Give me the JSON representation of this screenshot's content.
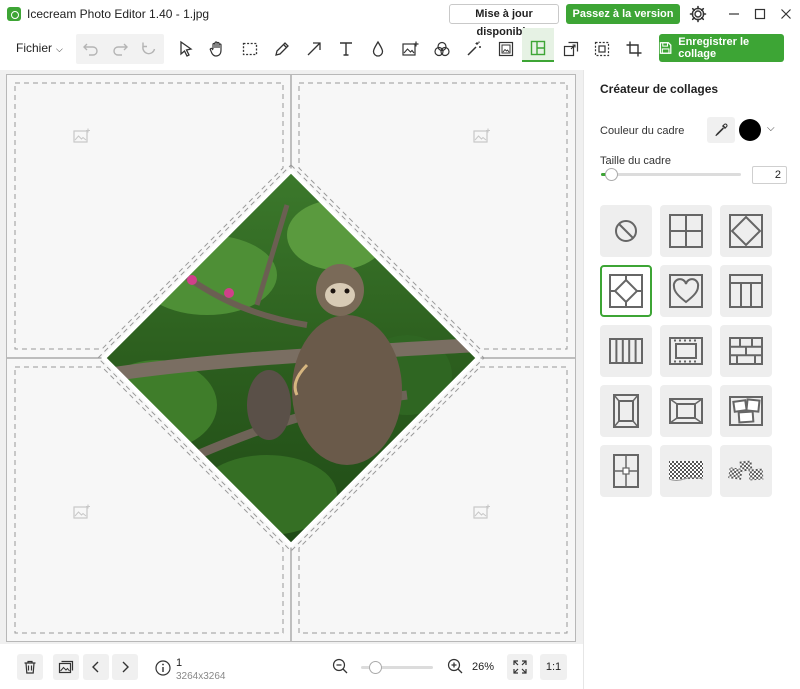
{
  "window": {
    "title": "Icecream Photo Editor 1.40 - 1.jpg",
    "update_label": "Mise à jour disponible",
    "pro_label": "Passez à la version PRO",
    "icons": [
      "settings-gear-icon",
      "minimize-icon",
      "maximize-icon",
      "close-icon"
    ]
  },
  "toolbar": {
    "file_label": "Fichier",
    "save_label": "Enregistrer le collage",
    "tools": [
      "undo",
      "redo",
      "reset",
      "select",
      "hand",
      "crop-select",
      "pencil",
      "arrow",
      "text",
      "drop",
      "add-image",
      "color-filters",
      "magic-wand",
      "frame",
      "collage",
      "resize",
      "stamp",
      "crop"
    ],
    "active_tool": "collage"
  },
  "panel": {
    "title": "Créateur de collages",
    "frame_color_label": "Couleur du cadre",
    "frame_color": "#000000",
    "frame_size_label": "Taille du cadre",
    "frame_size_value": "2",
    "frame_size_fraction": 0.05,
    "templates": [
      "none",
      "grid-4",
      "diamond",
      "diamond-corners",
      "heart",
      "three-columns-header",
      "five-columns",
      "film-strip",
      "bricks",
      "framed-vertical",
      "framed-center",
      "tilted-photos",
      "split-vertical",
      "checker-strip",
      "checker-scattered"
    ],
    "selected_template": "diamond-corners"
  },
  "status": {
    "page": "1",
    "dimensions": "3264x3264",
    "zoom": "26%",
    "zoom_fraction": 0.2,
    "one_to_one": "1:1"
  },
  "colors": {
    "accent": "#3da535",
    "canvas": "#f7f7f7"
  }
}
